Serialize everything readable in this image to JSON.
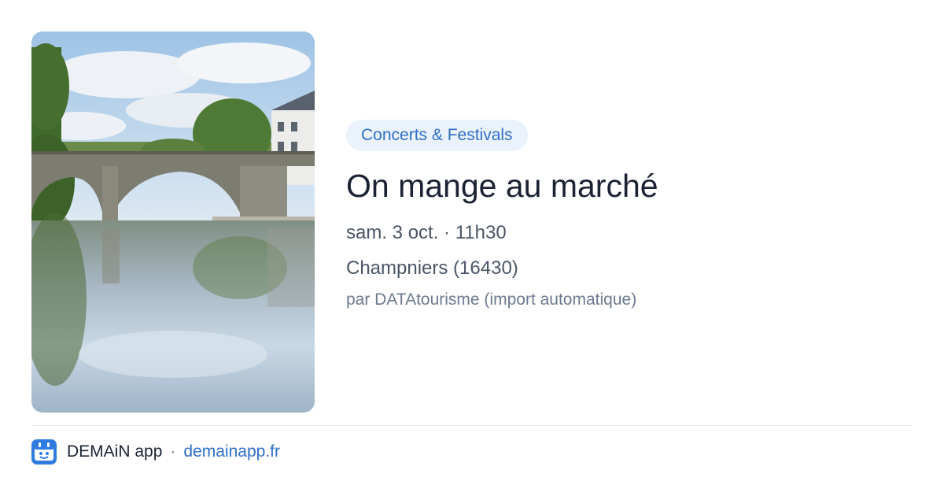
{
  "event": {
    "category": "Concerts & Festivals",
    "title": "On mange au marché",
    "datetime": "sam. 3 oct. · 11h30",
    "location": "Champniers (16430)",
    "source": "par DATAtourisme (import automatique)"
  },
  "footer": {
    "app_name": "DEMAiN app",
    "separator": "·",
    "site": "demainapp.fr"
  },
  "colors": {
    "accent": "#2f6fc9",
    "pill_background": "#eaf2fc",
    "title_text": "#1a2233",
    "meta_text": "#4a5568"
  },
  "icons": {
    "logo": "demain-app-logo-icon"
  }
}
